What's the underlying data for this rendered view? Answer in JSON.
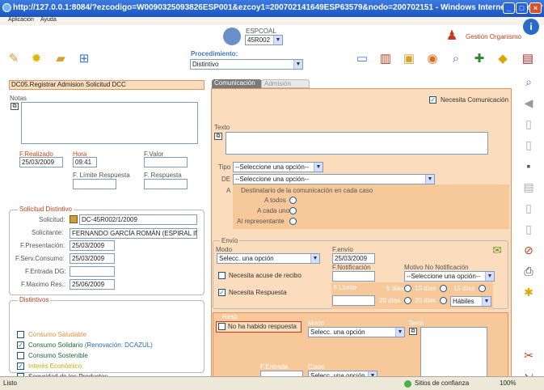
{
  "window": {
    "title": "http://127.0.0.1:8084/?ezcodigo=W0090325093826ESP001&ezcoy1=200702141649ESP63579&nodo=200702151 - Windows Internet Explorer"
  },
  "menu": [
    "Aplicación",
    "Ayuda"
  ],
  "header": {
    "user_code": "ESPCOAL",
    "site_select": "45R002",
    "gestion_label": "Gestión Organismo",
    "procedimiento_label": "Procedimiento:",
    "procedimiento_value": "Distintivo"
  },
  "main": {
    "section_title": "DC05.Registrar Admision Solicitud DCC",
    "notas_label": "Notas",
    "realizado": {
      "label": "F.Realizado",
      "value": "25/03/2009"
    },
    "hora": {
      "label": "Hora",
      "value": "09:41"
    },
    "fvalor": {
      "label": "F.Valor",
      "value": ""
    },
    "flimite": {
      "label": "F. Límite Respuesta",
      "value": ""
    },
    "frespuesta": {
      "label": "F. Respuesta",
      "value": ""
    },
    "solicitud": {
      "legend": "Solicitud Distintivo",
      "solicitud_label": "Solicitud:",
      "solicitud_value": "DC-45R002/1/2009",
      "solicitante_label": "Solicitante:",
      "solicitante_value": "FERNANDO GARCÍA ROMÁN (ESPIRAL INF",
      "fpres_label": "F.Presentación:",
      "fpres_value": "25/03/2009",
      "fserv_label": "F.Serv.Consumo:",
      "fserv_value": "25/03/2009",
      "fentrada_label": "F.Entrada DG:",
      "fentrada_value": "",
      "fmax_label": "F.Maximo Res.:",
      "fmax_value": "25/06/2009"
    },
    "distintivos": {
      "legend": "Distintivos",
      "items": [
        {
          "label": "Consumo Saludable",
          "checked": false,
          "color": "#e0923e"
        },
        {
          "label": "Consumo Solidario",
          "extra": " (Renovación: DCAZUL)",
          "checked": true,
          "color": "#1d6b3a"
        },
        {
          "label": "Consumo Sostenible",
          "checked": false,
          "color": "#1d6b3a"
        },
        {
          "label": "Interés Económico",
          "checked": true,
          "color": "#d6a800"
        },
        {
          "label": "Seguridad de los Productos",
          "checked": false,
          "color": "#333333"
        }
      ]
    }
  },
  "tabs": [
    "Comunicación",
    "Admisión"
  ],
  "comunicacion": {
    "necesita_label": "Necesita Comunicación",
    "texto_label": "Texto",
    "tipo_label": "Tipo",
    "tipo_value": "--Seleccione una opción--",
    "de_label": "DE",
    "de_value": "--Seleccione una opción--",
    "a_label": "A",
    "dest_label": "Destinatario de la comunicación en cada caso",
    "a_todos": "A todos",
    "a_cada_uno": "A cada uno",
    "al_representante": "Al representante",
    "envio": {
      "legend": "Envío",
      "modo_label": "Modo",
      "modo_value": "Selecc. una opción",
      "fenvio_label": "F.envío",
      "fenvio_value": "25/03/2009",
      "fnotif_label": "F.Notificación",
      "motivo_label": "Motivo No Notificación",
      "motivo_value": "--Seleccione una opción--",
      "acuse_label": "Necesita acuse de recibo",
      "necesita_resp_label": "Necesita Respuesta",
      "flimite_label": "F.Límite",
      "dias": [
        "5 días",
        "10 días",
        "15 días",
        "20 días",
        "30 días"
      ],
      "habiles": "Hábiles"
    },
    "resp": {
      "legend": "Resp",
      "no_resp_label": "No ha habido respuesta",
      "modo_label": "Modo",
      "modo_value": "Selecc. una opción",
      "texto_label": "Texto",
      "fentrada_label": "F.Entrada",
      "clase_label": "Clase",
      "clase_value": "Selecc. una opción"
    }
  },
  "status": {
    "left": "Listo",
    "zone": "Sitios de confianza",
    "zoom": "100%"
  },
  "colors": {
    "peach": "#fbdcbd",
    "panel": "#fbe1c8",
    "orange": "#e1935d"
  }
}
